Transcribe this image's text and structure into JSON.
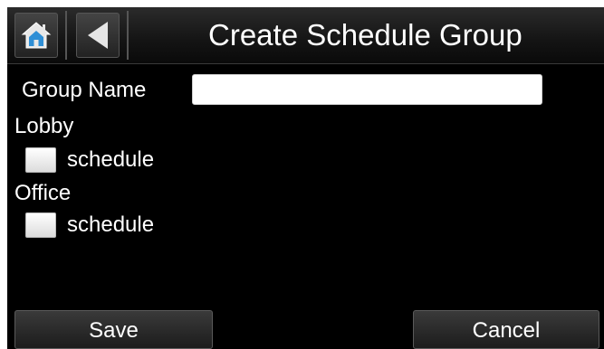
{
  "header": {
    "title": "Create Schedule Group",
    "home_icon": "home-icon",
    "back_icon": "back-arrow-icon"
  },
  "form": {
    "group_name_label": "Group Name",
    "group_name_value": "",
    "groups": [
      {
        "label": "Lobby",
        "option": "schedule",
        "checked": false
      },
      {
        "label": "Office",
        "option": "schedule",
        "checked": false
      }
    ]
  },
  "footer": {
    "save_label": "Save",
    "cancel_label": "Cancel"
  },
  "colors": {
    "background": "#000000",
    "accent": "#2f8fd6",
    "text": "#ffffff"
  }
}
